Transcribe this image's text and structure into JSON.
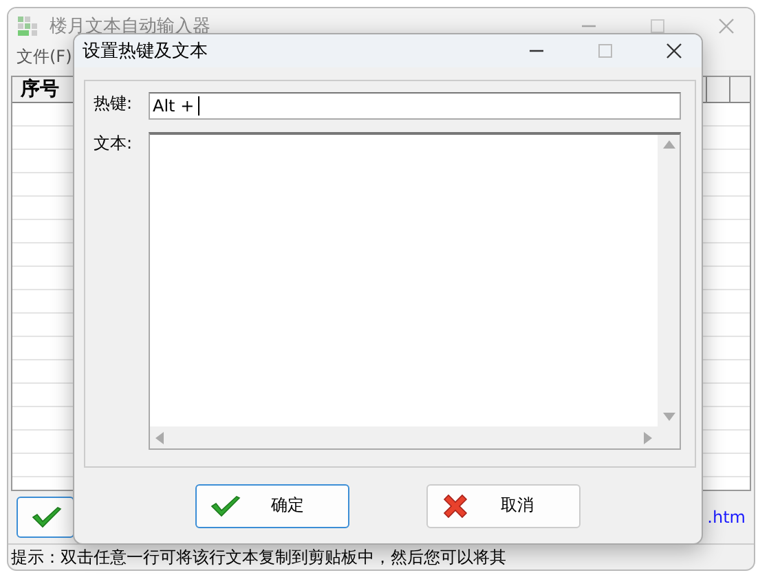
{
  "main_window": {
    "title": "楼月文本自动输入器",
    "menu": [
      {
        "label": "文件(F)"
      }
    ],
    "table": {
      "columns": [
        "序号"
      ]
    },
    "button": {
      "kind": "ok"
    },
    "link": ".htm",
    "status_bar": "提示：双击任意一行可将该行文本复制到剪贴板中，然后您可以将其"
  },
  "dialog": {
    "title": "设置热键及文本",
    "hotkey_label": "热键:",
    "hotkey_value": "Alt +",
    "text_label": "文本:",
    "buttons": [
      {
        "label": "确定",
        "kind": "ok",
        "focused": true
      },
      {
        "label": "取消",
        "kind": "cancel",
        "focused": false
      }
    ]
  }
}
